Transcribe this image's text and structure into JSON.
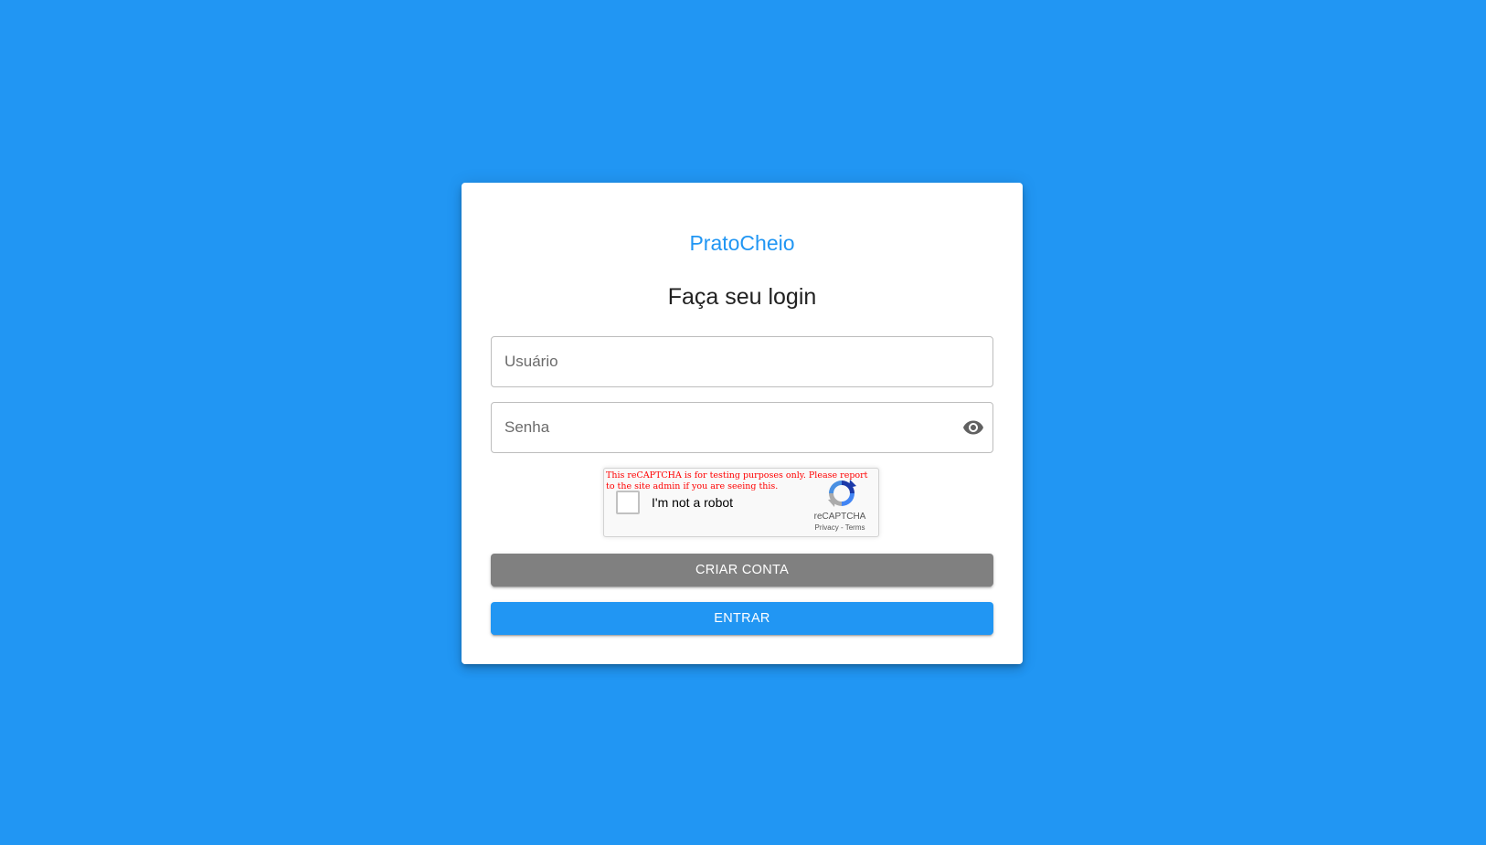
{
  "brand": {
    "name": "PratoCheio",
    "color": "#2196f3"
  },
  "login": {
    "heading": "Faça seu login",
    "username_placeholder": "Usuário",
    "password_placeholder": "Senha",
    "password_toggle_icon": "eye-icon"
  },
  "captcha": {
    "warning": "This reCAPTCHA is for testing purposes only. Please report to the site admin if you are seeing this.",
    "label": "I'm not a robot",
    "brand": "reCAPTCHA",
    "privacy": "Privacy",
    "separator": " - ",
    "terms": "Terms",
    "checked": false
  },
  "actions": {
    "create_account": "CRIAR CONTA",
    "login": "ENTRAR",
    "create_account_color": "#808080",
    "login_color": "#2196f3"
  },
  "page": {
    "background_color": "#2196f3"
  }
}
